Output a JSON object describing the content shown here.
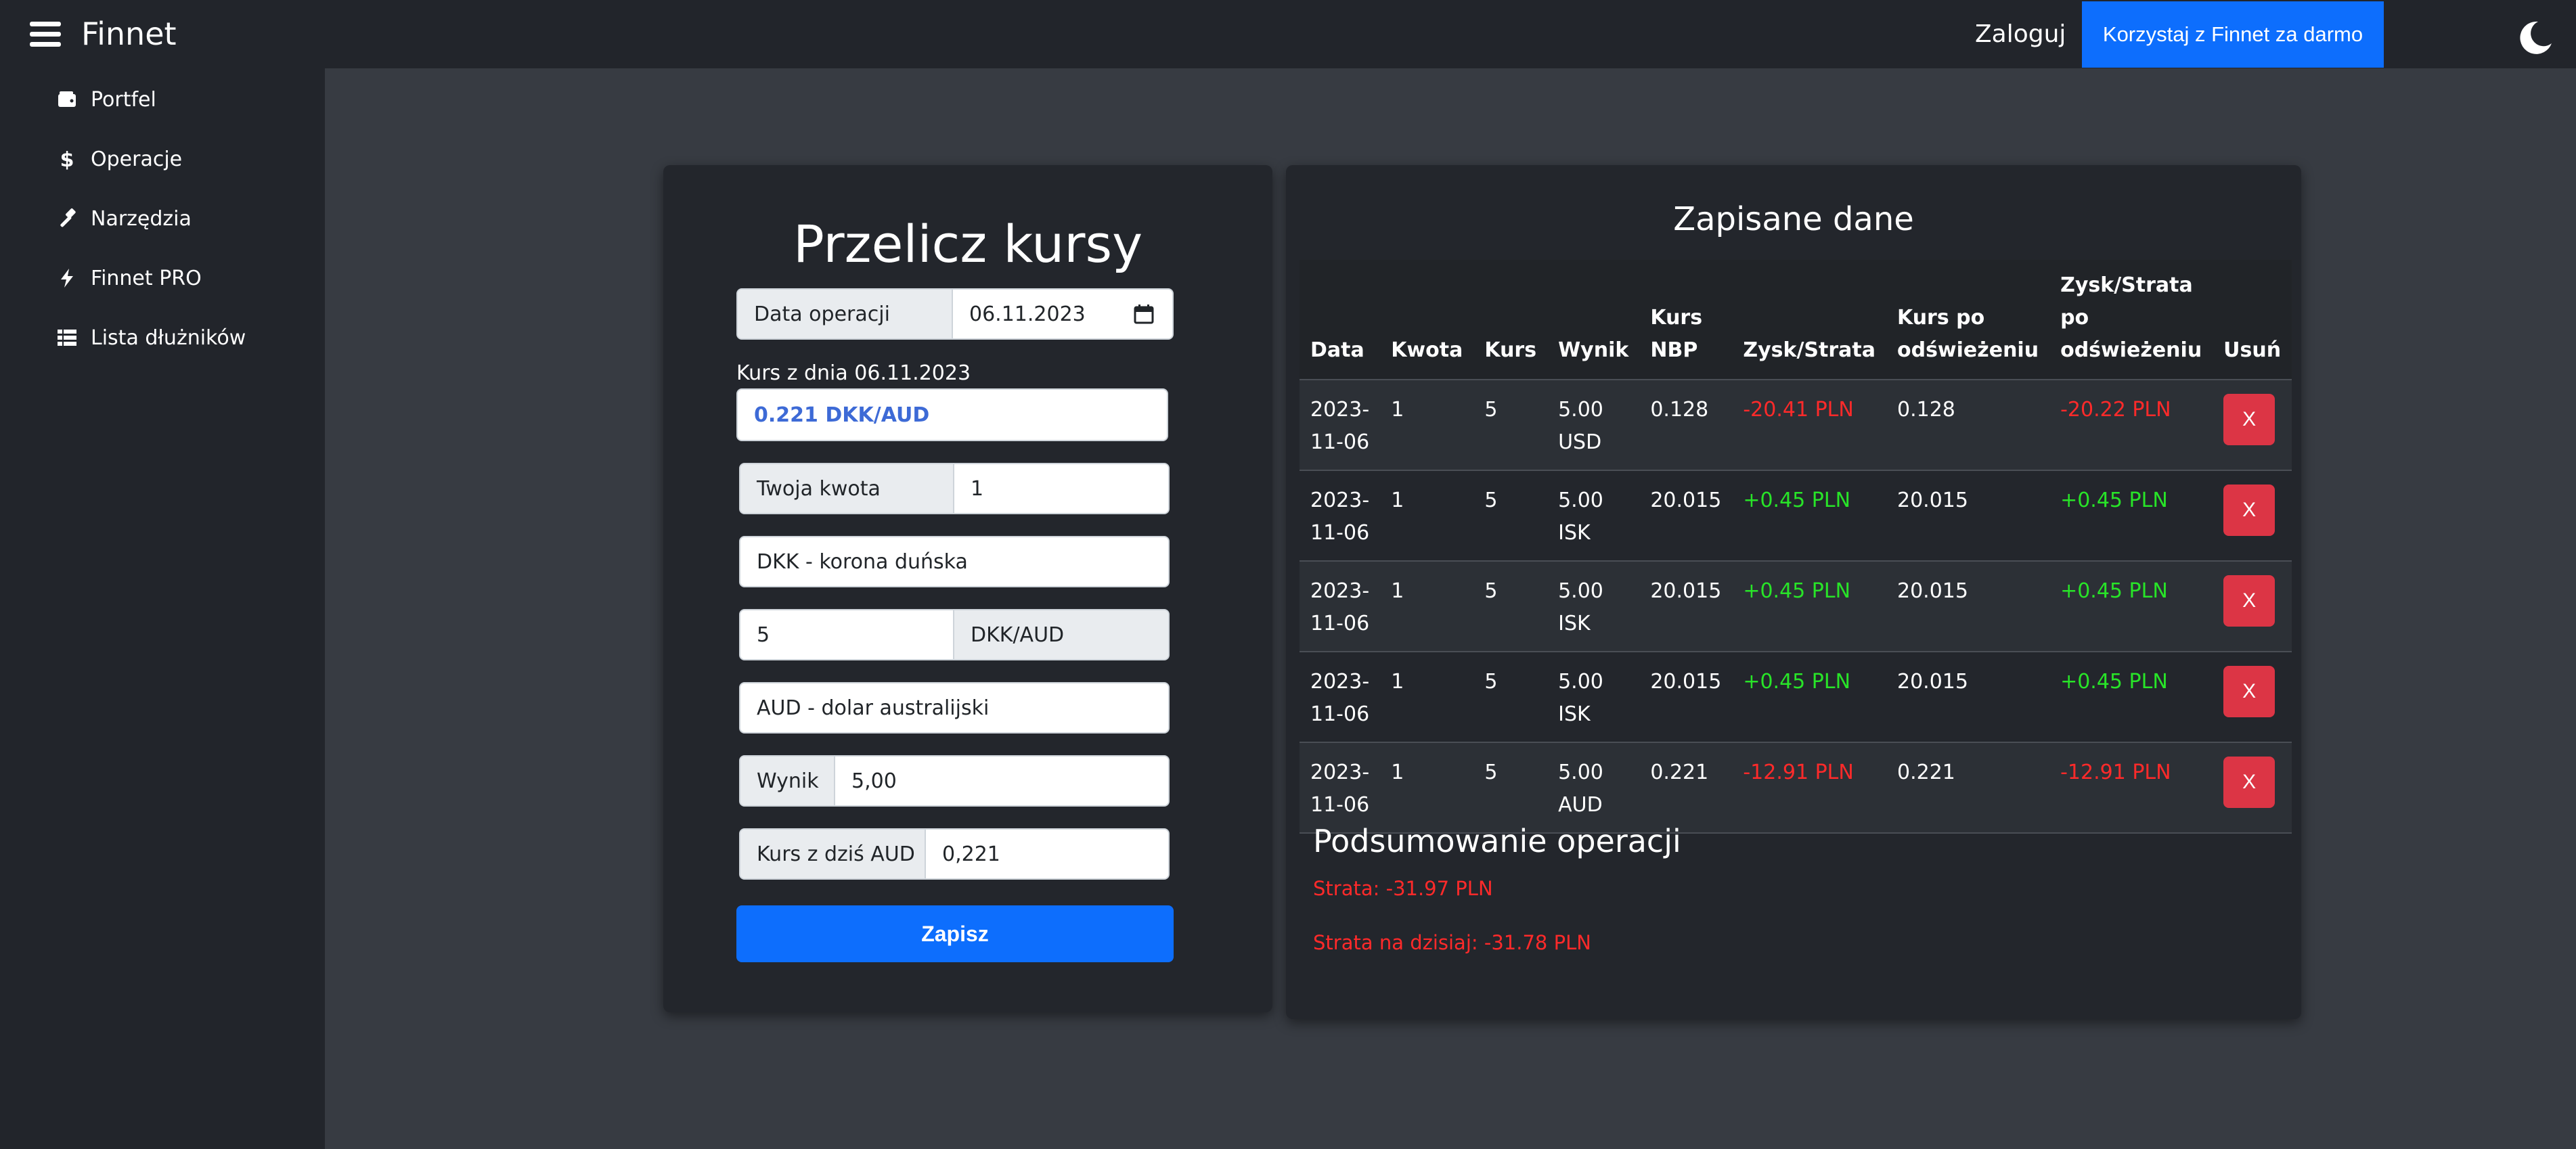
{
  "header": {
    "brand": "Finnet",
    "login_label": "Zaloguj",
    "cta_label": "Korzystaj z Finnet za darmo",
    "menu_icon": "hamburger-menu-icon",
    "theme_icon": "moon-icon"
  },
  "sidebar": {
    "items": [
      {
        "label": "Portfel",
        "icon": "wallet-icon"
      },
      {
        "label": "Operacje",
        "icon": "dollar-icon"
      },
      {
        "label": "Narzędzia",
        "icon": "hammer-icon"
      },
      {
        "label": "Finnet PRO",
        "icon": "lightning-icon"
      },
      {
        "label": "Lista dłużników",
        "icon": "list-icon"
      }
    ]
  },
  "converter": {
    "title": "Przelicz kursy",
    "date_label": "Data operacji",
    "date_value": "06.11.2023",
    "rate_caption": "Kurs z dnia 06.11.2023",
    "rate_value": "0.221 DKK/AUD",
    "amount_label": "Twoja kwota",
    "amount_value": "1",
    "from_currency": "DKK - korona duńska",
    "rate_input_value": "5",
    "rate_unit": "DKK/AUD",
    "to_currency": "AUD - dolar australijski",
    "result_label": "Wynik",
    "result_value": "5,00",
    "today_label": "Kurs z dziś AUD",
    "today_value": "0,221",
    "save_label": "Zapisz"
  },
  "saved": {
    "title": "Zapisane dane",
    "columns": [
      "Data",
      "Kwota",
      "Kurs",
      "Wynik",
      "Kurs NBP",
      "Zysk/Strata",
      "Kurs po odświeżeniu",
      "Zysk/Strata po odświeżeniu",
      "Usuń"
    ],
    "rows": [
      {
        "date": "2023-11-06",
        "amount": "1",
        "rate": "5",
        "result": "5.00 USD",
        "nbp": "0.128",
        "pl": "-20.41 PLN",
        "pl_type": "neg",
        "rate_refresh": "0.128",
        "pl_refresh": "-20.22 PLN",
        "pl_refresh_type": "neg",
        "delete_label": "X"
      },
      {
        "date": "2023-11-06",
        "amount": "1",
        "rate": "5",
        "result": "5.00 ISK",
        "nbp": "20.015",
        "pl": "+0.45 PLN",
        "pl_type": "pos",
        "rate_refresh": "20.015",
        "pl_refresh": "+0.45 PLN",
        "pl_refresh_type": "pos",
        "delete_label": "X"
      },
      {
        "date": "2023-11-06",
        "amount": "1",
        "rate": "5",
        "result": "5.00 ISK",
        "nbp": "20.015",
        "pl": "+0.45 PLN",
        "pl_type": "pos",
        "rate_refresh": "20.015",
        "pl_refresh": "+0.45 PLN",
        "pl_refresh_type": "pos",
        "delete_label": "X"
      },
      {
        "date": "2023-11-06",
        "amount": "1",
        "rate": "5",
        "result": "5.00 ISK",
        "nbp": "20.015",
        "pl": "+0.45 PLN",
        "pl_type": "pos",
        "rate_refresh": "20.015",
        "pl_refresh": "+0.45 PLN",
        "pl_refresh_type": "pos",
        "delete_label": "X"
      },
      {
        "date": "2023-11-06",
        "amount": "1",
        "rate": "5",
        "result": "5.00 AUD",
        "nbp": "0.221",
        "pl": "-12.91 PLN",
        "pl_type": "neg",
        "rate_refresh": "0.221",
        "pl_refresh": "-12.91 PLN",
        "pl_refresh_type": "neg",
        "delete_label": "X"
      }
    ],
    "summary_title": "Podsumowanie operacji",
    "summary_loss": "Strata: -31.97 PLN",
    "summary_loss_today": "Strata na dzisiaj: -31.78 PLN"
  },
  "colors": {
    "accent": "#0d6efd",
    "danger": "#dc3545",
    "loss_text": "#ff2a2a",
    "gain_text": "#28e428",
    "background": "#373b42",
    "panel": "#22252b"
  }
}
